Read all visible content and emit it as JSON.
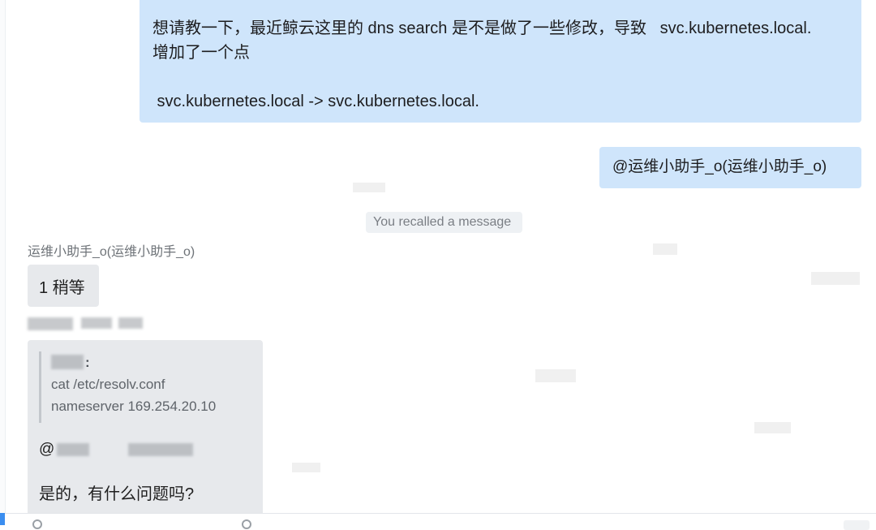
{
  "messages": {
    "outgoing_1": {
      "line_1": "想请教一下，最近鲸云这里的 dns search 是不是做了一些修改，导致   svc.kubernetes.local.",
      "line_2": "增加了一个点",
      "line_3": " svc.kubernetes.local -> svc.kubernetes.local."
    },
    "outgoing_2": {
      "text": "@运维小助手_o(运维小助手_o)"
    },
    "system_notice": {
      "text": "You recalled a message"
    },
    "incoming_1": {
      "sender": "运维小助手_o(运维小助手_o)",
      "text": "1 稍等"
    },
    "incoming_2": {
      "quote_colon": ":",
      "quote_lines": [
        "cat /etc/resolv.conf",
        "nameserver 169.254.20.10"
      ],
      "mention_prefix": "@",
      "reply": "是的，有什么问题吗?"
    }
  },
  "colors": {
    "outgoing_bubble": "#cfe5fb",
    "incoming_bubble": "#e7e9ec",
    "system_notice_bg": "#eef1f4",
    "input_accent": "#3b8ef0"
  },
  "icons": [
    "emoji-icon",
    "attachment-icon"
  ]
}
